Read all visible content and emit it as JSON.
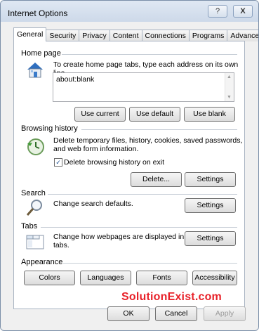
{
  "window": {
    "title": "Internet Options",
    "help_glyph": "?",
    "close_glyph": "X"
  },
  "tabs": [
    {
      "label": "General",
      "active": true
    },
    {
      "label": "Security",
      "active": false
    },
    {
      "label": "Privacy",
      "active": false
    },
    {
      "label": "Content",
      "active": false
    },
    {
      "label": "Connections",
      "active": false
    },
    {
      "label": "Programs",
      "active": false
    },
    {
      "label": "Advanced",
      "active": false
    }
  ],
  "home_page": {
    "label": "Home page",
    "description": "To create home page tabs, type each address on its own line.",
    "value": "about:blank",
    "buttons": {
      "use_current": "Use current",
      "use_default": "Use default",
      "use_blank": "Use blank"
    }
  },
  "browsing_history": {
    "label": "Browsing history",
    "description_line1": "Delete temporary files, history, cookies, saved passwords,",
    "description_line2": "and web form information.",
    "checkbox_label": "Delete browsing history on exit",
    "checkbox_checked": true,
    "check_glyph": "✓",
    "buttons": {
      "delete": "Delete...",
      "settings": "Settings"
    }
  },
  "search": {
    "label": "Search",
    "description": "Change search defaults.",
    "settings": "Settings"
  },
  "tabs_section": {
    "label": "Tabs",
    "description_line1": "Change how webpages are displayed in",
    "description_line2": "tabs.",
    "settings": "Settings"
  },
  "appearance": {
    "label": "Appearance",
    "buttons": {
      "colors": "Colors",
      "languages": "Languages",
      "fonts": "Fonts",
      "accessibility": "Accessibility"
    }
  },
  "watermark": "SolutionExist.com",
  "footer": {
    "ok": "OK",
    "cancel": "Cancel",
    "apply": "Apply"
  },
  "colors": {
    "accent_blue": "#1a5fb4",
    "watermark_red": "#e8222a",
    "disabled_text": "#9a9a9a"
  }
}
